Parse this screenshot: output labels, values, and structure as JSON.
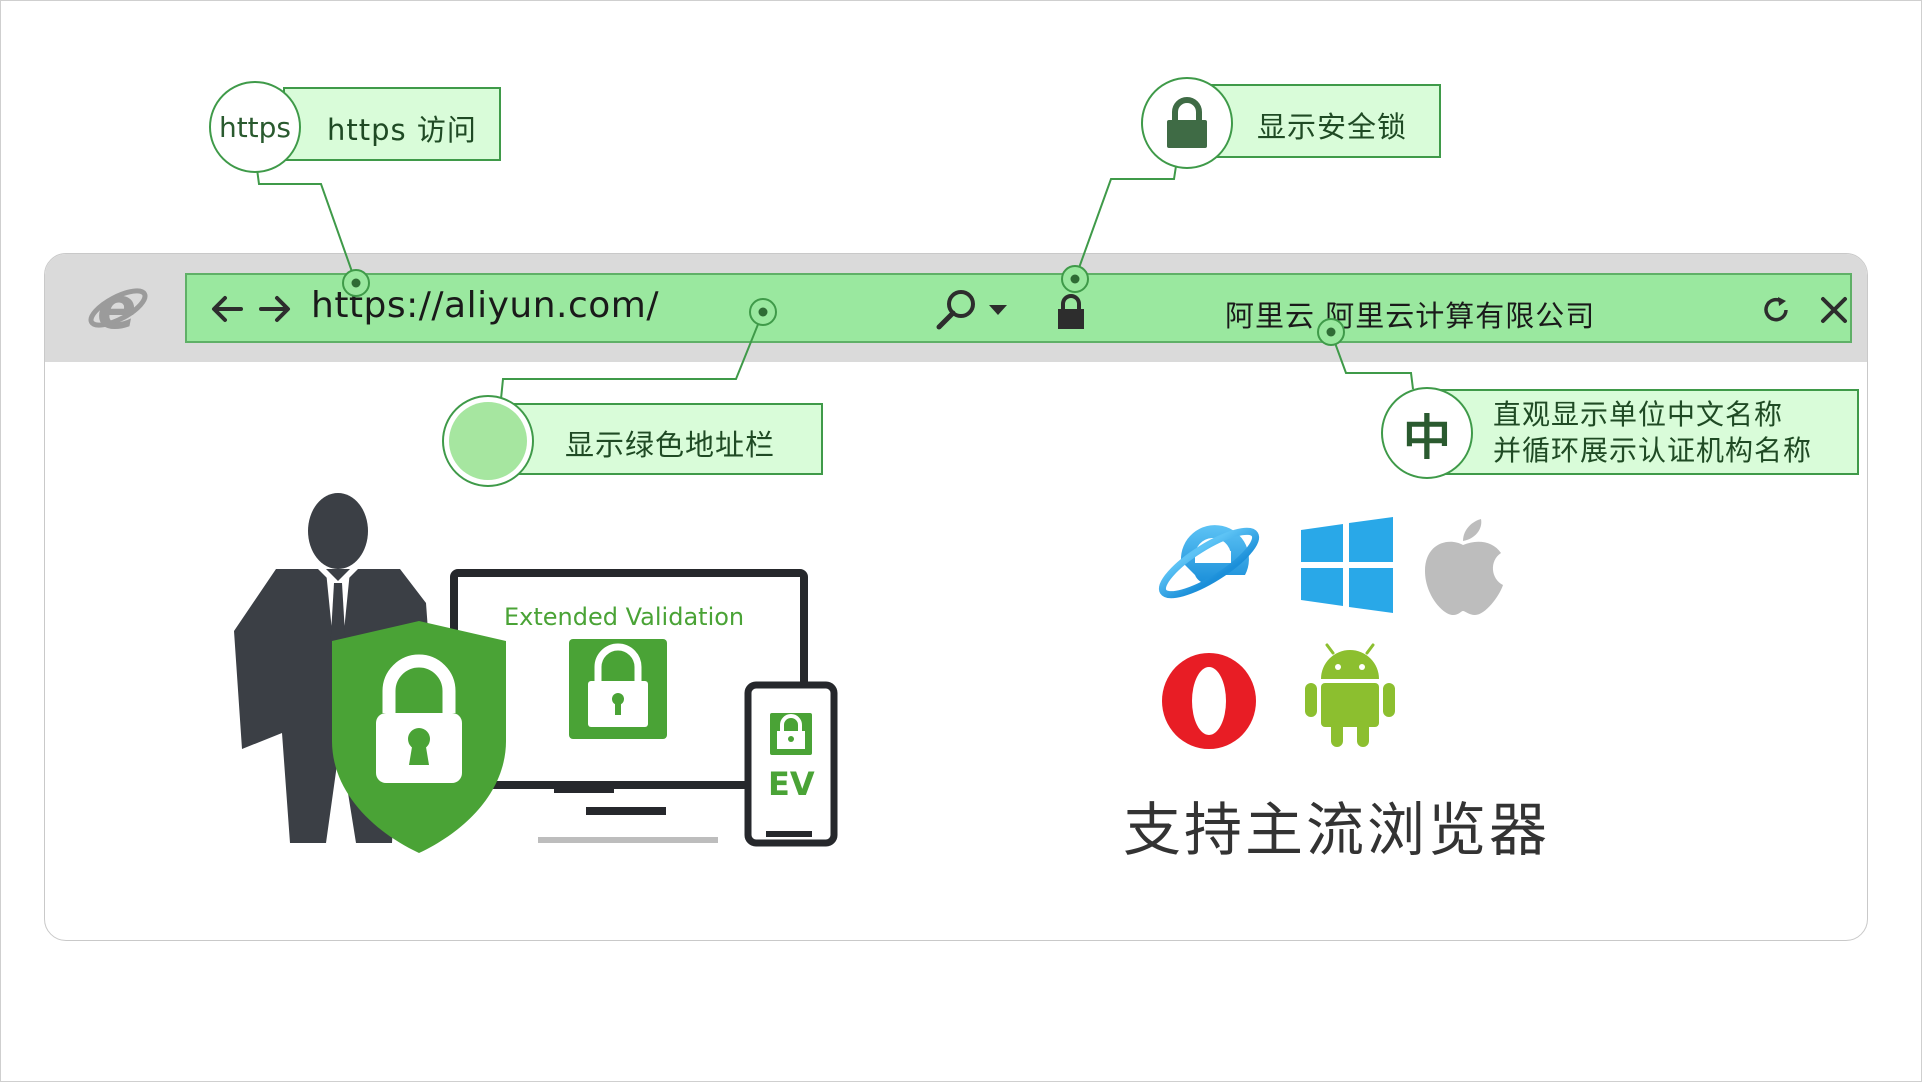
{
  "browser": {
    "url": "https://aliyun.com/",
    "organization": "阿里云  阿里云计算有限公司"
  },
  "callouts": {
    "https": {
      "bubble": "https",
      "label": "https 访问"
    },
    "lock": {
      "label": "显示安全锁"
    },
    "green_bar": {
      "label": "显示绿色地址栏"
    },
    "org_name": {
      "bubble": "中",
      "line1": "直观显示单位中文名称",
      "line2": "并循环展示认证机构名称"
    }
  },
  "illustration": {
    "monitor_title": "Extended Validation",
    "phone_badge": "EV"
  },
  "browsers": {
    "title": "支持主流浏览器",
    "icons": [
      "internet-explorer-icon",
      "windows-icon",
      "apple-icon",
      "opera-icon",
      "android-icon"
    ]
  },
  "colors": {
    "address_bar": "#9ae89f",
    "callout_bg": "#d9fcd9",
    "accent_green": "#3f9a49",
    "shield_green": "#4aa336"
  }
}
